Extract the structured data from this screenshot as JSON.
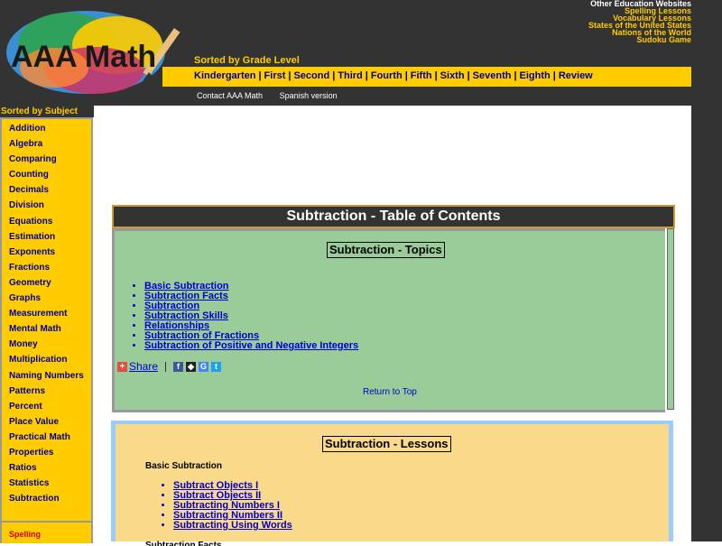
{
  "logo": {
    "text": "AAA Math"
  },
  "external_links": [
    "Other Education Websites",
    "Spelling Lessons",
    "Vocabulary Lessons",
    "States of the United States",
    "Nations of the World",
    "Sudoku Game"
  ],
  "grade_nav": {
    "title": "Sorted by Grade Level",
    "items": [
      "Kindergarten",
      "First",
      "Second",
      "Third",
      "Fourth",
      "Fifth",
      "Sixth",
      "Seventh",
      "Eighth",
      "Review"
    ]
  },
  "secondary_links": [
    "Contact AAA Math",
    "Spanish version"
  ],
  "subject_nav": {
    "title": "Sorted by Subject",
    "items": [
      "Addition",
      "Algebra",
      "Comparing",
      "Counting",
      "Decimals",
      "Division",
      "Equations",
      "Estimation",
      "Exponents",
      "Fractions",
      "Geometry",
      "Graphs",
      "Measurement",
      "Mental Math",
      "Money",
      "Multiplication",
      "Naming Numbers",
      "Patterns",
      "Percent",
      "Place Value",
      "Practical Math",
      "Properties",
      "Ratios",
      "Statistics",
      "Subtraction"
    ],
    "spelling": "Spelling"
  },
  "toc": {
    "title": "Subtraction - Table of Contents",
    "topics_title": "Subtraction - Topics",
    "topics": [
      "Basic Subtraction",
      "Subtraction Facts",
      "Subtraction",
      "Subtraction Skills",
      "Relationships",
      "Subtraction of Fractions",
      "Subtraction of Positive and Negative Integers"
    ],
    "share_label": "Share",
    "return_label": "Return to Top"
  },
  "lessons": {
    "title": "Subtraction - Lessons",
    "section_label": "Basic Subtraction",
    "items": [
      "Subtract Objects I",
      "Subtract Objects II",
      "Subtracting Numbers I",
      "Subtracting Numbers II",
      "Subtracting Using Words"
    ],
    "next_section_label": "Subtraction Facts"
  },
  "colors": {
    "header_bg": "#333333",
    "accent": "#ffcc00",
    "toc_panel": "#99cc99",
    "lessons_panel": "#f9d98a",
    "link": "#0000cc"
  }
}
